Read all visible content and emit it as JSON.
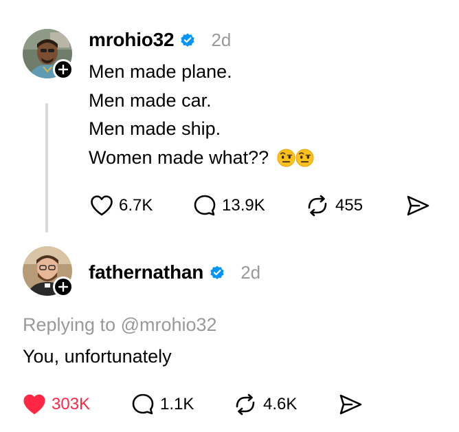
{
  "post": {
    "username": "mrohio32",
    "time": "2d",
    "lines": [
      "Men made plane.",
      "Men made car.",
      "Men made ship.",
      "Women made what??"
    ],
    "emojis": [
      "raised-eyebrow-emoji",
      "raised-eyebrow-emoji"
    ],
    "likes": "6.7K",
    "replies": "13.9K",
    "reposts": "455"
  },
  "reply": {
    "username": "fathernathan",
    "time": "2d",
    "replying_to": "Replying to @mrohio32",
    "text": "You, unfortunately",
    "likes": "303K",
    "liked": true,
    "replies": "1.1K",
    "reposts": "4.6K"
  },
  "colors": {
    "verified": "#0095f6",
    "like_active": "#ff2744",
    "muted_text": "#999999",
    "thread_line": "#d9d9d9"
  },
  "icons": [
    "heart-icon",
    "comment-icon",
    "repost-icon",
    "share-icon",
    "plus-icon",
    "verified-badge-icon"
  ]
}
